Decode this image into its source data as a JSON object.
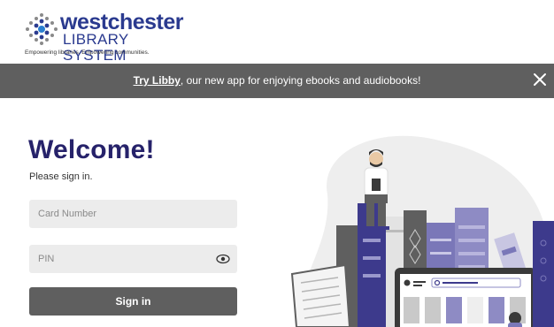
{
  "brand": {
    "name_top": "westchester",
    "name_bottom": "LIBRARY SYSTEM",
    "tagline": "Empowering libraries. Empowering communities."
  },
  "banner": {
    "link_text": "Try Libby",
    "message": ", our new app for enjoying ebooks and audiobooks!",
    "close_icon": "close-icon"
  },
  "login": {
    "title": "Welcome!",
    "subtitle": "Please sign in.",
    "card_placeholder": "Card Number",
    "pin_placeholder": "PIN",
    "signin_label": "Sign in",
    "show_pin_icon": "eye-icon"
  },
  "colors": {
    "brand_blue": "#2a3a8f",
    "title_navy": "#26226a",
    "banner_gray": "#5f5f5f",
    "field_gray": "#ececec",
    "illustration_purple": "#3d3a8c"
  }
}
